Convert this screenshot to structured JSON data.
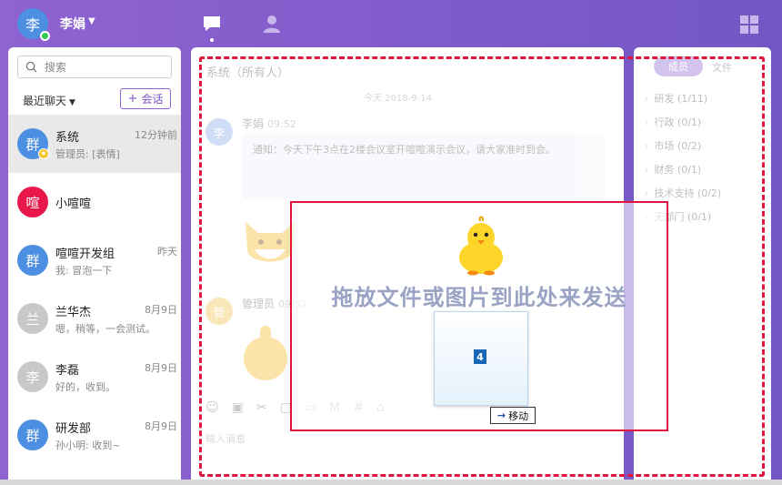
{
  "user": {
    "avatar_char": "李",
    "name": "李娟"
  },
  "nav": {
    "chat_icon": "chat-bubble-icon",
    "contacts_icon": "person-icon",
    "apps_icon": "grid-icon"
  },
  "sidebar": {
    "search_placeholder": "搜索",
    "recent_label": "最近聊天",
    "new_chat_label": "会话",
    "conversations": [
      {
        "avatar": "群",
        "color": "#4d8fe0",
        "name": "系统",
        "time": "12分钟前",
        "last": "管理员: [表情]",
        "active": true,
        "badge": "star"
      },
      {
        "avatar": "喧",
        "color": "#e8194a",
        "name": "小喧喧",
        "time": "",
        "last": ""
      },
      {
        "avatar": "群",
        "color": "#4d8fe0",
        "name": "喧喧开发组",
        "time": "昨天",
        "last": "我: 冒泡一下"
      },
      {
        "avatar": "兰",
        "color": "#c8c8c8",
        "name": "兰华杰",
        "time": "8月9日",
        "last": "嗯，稍等，一会测试。"
      },
      {
        "avatar": "李",
        "color": "#c8c8c8",
        "name": "李磊",
        "time": "8月9日",
        "last": "好的，收到。"
      },
      {
        "avatar": "群",
        "color": "#4d8fe0",
        "name": "研发部",
        "time": "8月9日",
        "last": "孙小明: 收到~"
      }
    ]
  },
  "chat": {
    "title": "系统（所有人）",
    "date": "今天 2018-9-14",
    "messages": [
      {
        "avatar": "李",
        "sender": "李娟",
        "time": "09:52",
        "text": "通知：今天下午3点在2楼会议室开喧喧演示会议，请大家准时到会。"
      },
      {
        "avatar": "管",
        "sender": "管理员",
        "time": "09:52",
        "text": ""
      }
    ],
    "input_placeholder": "输入消息"
  },
  "right_panel": {
    "tabs": [
      "成员",
      "文件"
    ],
    "departments": [
      "研发 (1/11)",
      "行政 (0/1)",
      "市场 (0/2)",
      "财务 (0/1)",
      "技术支持 (0/2)",
      "无部门 (0/1)"
    ]
  },
  "drop_overlay": {
    "message": "拖放文件或图片到此处来发送",
    "drag_count": "4",
    "move_label": "移动",
    "border_color": "#e0163c"
  }
}
